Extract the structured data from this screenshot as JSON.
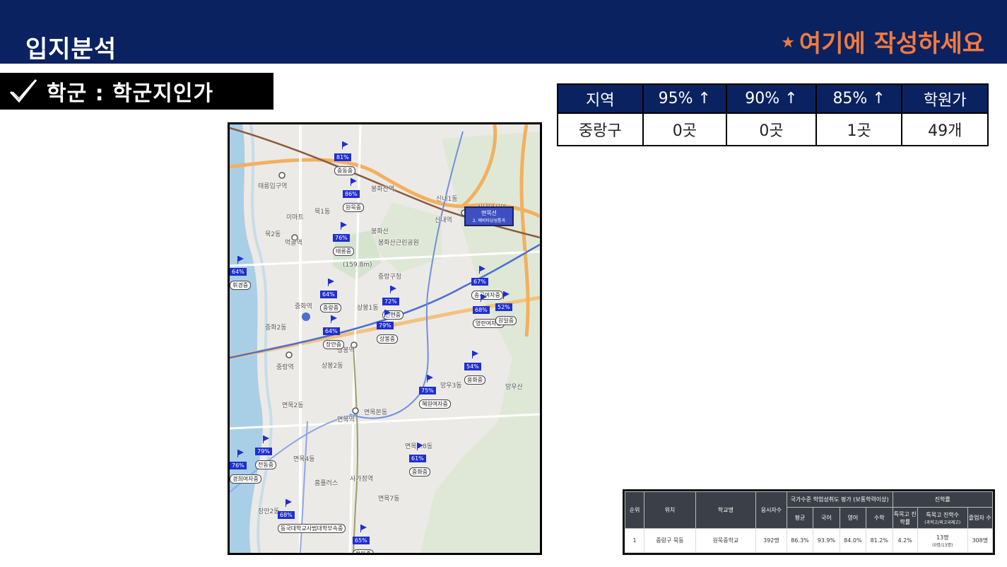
{
  "header": {
    "title": "입지분석",
    "note": "여기에 작성하세요",
    "note_star": "★"
  },
  "section": {
    "title": "학군 : 학군지인가"
  },
  "summary_table": {
    "headers": [
      "지역",
      "95% ↑",
      "90% ↑",
      "85% ↑",
      "학원가"
    ],
    "row": [
      "중랑구",
      "0곳",
      "0곳",
      "1곳",
      "49개"
    ]
  },
  "map": {
    "place_labels": [
      "태릉입구역",
      "묵1동",
      "묵2동",
      "먹골역",
      "중화역",
      "중화2동",
      "상봉역",
      "상봉1동",
      "상봉2동",
      "중랑역",
      "면목2동",
      "면목본동",
      "면목역",
      "사가정역",
      "면목3.8동",
      "면목7동",
      "망우3동",
      "신내1동",
      "봉화산역",
      "신내역",
      "봉화산",
      "(159.8m)",
      "봉화산근린공원",
      "중랑구청",
      "망우산",
      "장안2동",
      "면목4동",
      "이마트",
      "홈플러스",
      "신내데시앙"
    ],
    "badges": [
      {
        "pct": "81%",
        "name": "중동중"
      },
      {
        "pct": "86%",
        "name": "원묵중"
      },
      {
        "pct": "76%",
        "name": "태릉중"
      },
      {
        "pct": "64%",
        "name": "중랑중"
      },
      {
        "pct": "72%",
        "name": "신현중"
      },
      {
        "pct": "79%",
        "name": "상봉중"
      },
      {
        "pct": "64%",
        "name": "장안중"
      },
      {
        "pct": "67%",
        "name": "송곡여자중"
      },
      {
        "pct": "68%",
        "name": "영란여자중"
      },
      {
        "pct": "52%",
        "name": "원일중"
      },
      {
        "pct": "54%",
        "name": "용화중"
      },
      {
        "pct": "75%",
        "name": "혜원여자중"
      },
      {
        "pct": "79%",
        "name": "전동중"
      },
      {
        "pct": "61%",
        "name": "중화중"
      },
      {
        "pct": "68%",
        "name": "동국대학교사범대학부속중"
      },
      {
        "pct": "65%",
        "name": "용마중"
      },
      {
        "pct": "64%",
        "name": "휘경중"
      },
      {
        "pct": "76%",
        "name": "경희여자중"
      }
    ],
    "line_box": {
      "line": "면목선",
      "sub": "2. 예비타당성통과"
    }
  },
  "detail_table": {
    "h_rank": "순위",
    "h_loc": "위치",
    "h_school": "학교명",
    "h_count": "응시자수",
    "h_group1": "국가수준 학업성취도 평가 (보통학력이상)",
    "h_group2": "진학률",
    "h_avg": "평균",
    "h_kor": "국어",
    "h_eng": "영어",
    "h_math": "수학",
    "h_special": "특목고 진학률",
    "h_special_n": "특목고 진학수",
    "h_special_n_sub": "(과학고/외고국제고)",
    "h_grad": "졸업자 수",
    "row": {
      "rank": "1",
      "loc": "중랑구 묵동",
      "school": "원묵중학교",
      "count": "392명",
      "avg": "86.3%",
      "kor": "93.9%",
      "eng": "84.0%",
      "math": "81.2%",
      "special": "4.2%",
      "special_n": "13명",
      "special_n_sub": "(0명/13명)",
      "grad": "308명"
    }
  }
}
